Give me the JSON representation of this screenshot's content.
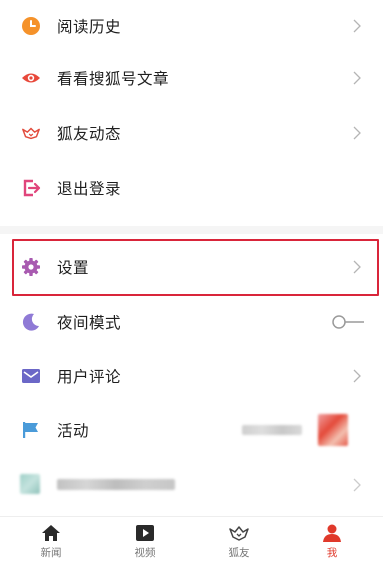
{
  "menu": {
    "history": {
      "label": "阅读历史",
      "icon": "clock-icon",
      "color": "#f5922a"
    },
    "sohu_articles": {
      "label": "看看搜狐号文章",
      "icon": "eye-icon",
      "color": "#e8483a"
    },
    "friends_feed": {
      "label": "狐友动态",
      "icon": "fox-icon",
      "color": "#e24b3c"
    },
    "logout": {
      "label": "退出登录",
      "icon": "logout-icon",
      "color": "#e0457b"
    },
    "settings": {
      "label": "设置",
      "icon": "gear-icon",
      "color": "#a85ab0"
    },
    "night_mode": {
      "label": "夜间模式",
      "icon": "moon-icon",
      "color": "#8f7ad6",
      "toggle_on": false
    },
    "comments": {
      "label": "用户评论",
      "icon": "mail-icon",
      "color": "#6b67c7"
    },
    "activity": {
      "label": "活动",
      "icon": "flag-icon",
      "color": "#4a9bd9"
    }
  },
  "tabbar": {
    "news": "新闻",
    "video": "视频",
    "friends": "狐友",
    "me": "我"
  },
  "colors": {
    "accent": "#e0392b",
    "highlight_border": "#d9253a"
  }
}
